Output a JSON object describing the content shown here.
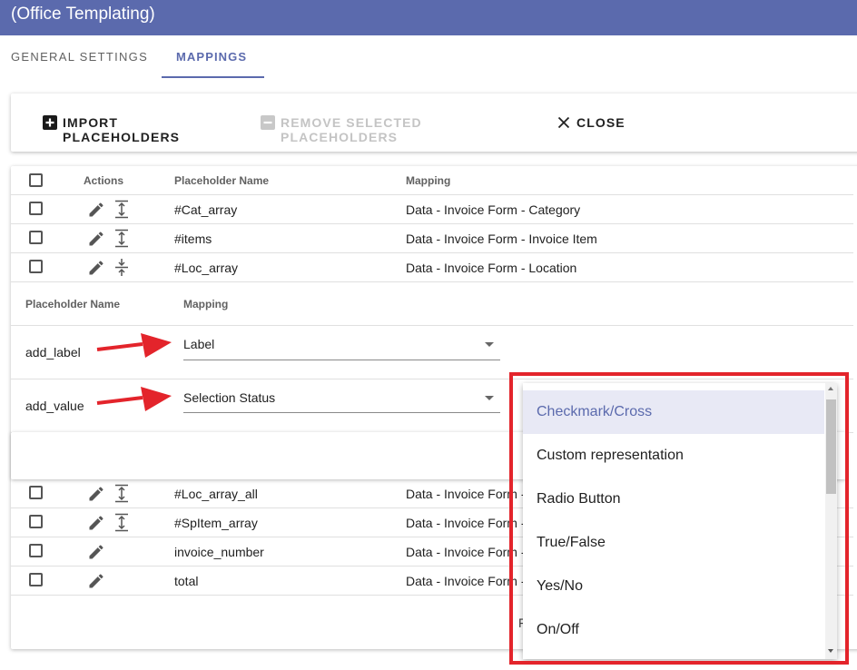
{
  "header": {
    "title": "(Office Templating)"
  },
  "tabs": [
    {
      "label": "GENERAL SETTINGS",
      "active": false
    },
    {
      "label": "MAPPINGS",
      "active": true
    }
  ],
  "toolbar": {
    "import_label": "IMPORT PLACEHOLDERS",
    "remove_label": "REMOVE SELECTED PLACEHOLDERS",
    "close_label": "CLOSE"
  },
  "table": {
    "headers": {
      "actions": "Actions",
      "placeholder": "Placeholder Name",
      "mapping": "Mapping"
    },
    "rows_top": [
      {
        "name": "#Cat_array",
        "mapping": "Data - Invoice Form - Category"
      },
      {
        "name": "#items",
        "mapping": "Data - Invoice Form - Invoice Item"
      },
      {
        "name": "#Loc_array",
        "mapping": "Data - Invoice Form - Location"
      }
    ],
    "rows_bottom": [
      {
        "name": "#Loc_array_all",
        "mapping": "Data - Invoice Form -"
      },
      {
        "name": "#SpItem_array",
        "mapping": "Data - Invoice Form -"
      },
      {
        "name": "invoice_number",
        "mapping": "Data - Invoice Form -"
      },
      {
        "name": "total",
        "mapping": "Data - Invoice Form -"
      }
    ]
  },
  "sub_table": {
    "headers": {
      "placeholder": "Placeholder Name",
      "mapping": "Mapping"
    },
    "rows": [
      {
        "name": "add_label",
        "value": "Label"
      },
      {
        "name": "add_value",
        "value": "Selection Status"
      }
    ]
  },
  "dropdown": {
    "options": [
      "Checkmark/Cross",
      "Custom representation",
      "Radio Button",
      "True/False",
      "Yes/No",
      "On/Off"
    ],
    "selected": "Checkmark/Cross"
  },
  "pagination_partial": "F",
  "colors": {
    "header": "#5b6aad",
    "accent": "#5b6aad",
    "highlight": "#e3242b",
    "arrow": "#e3242b"
  }
}
